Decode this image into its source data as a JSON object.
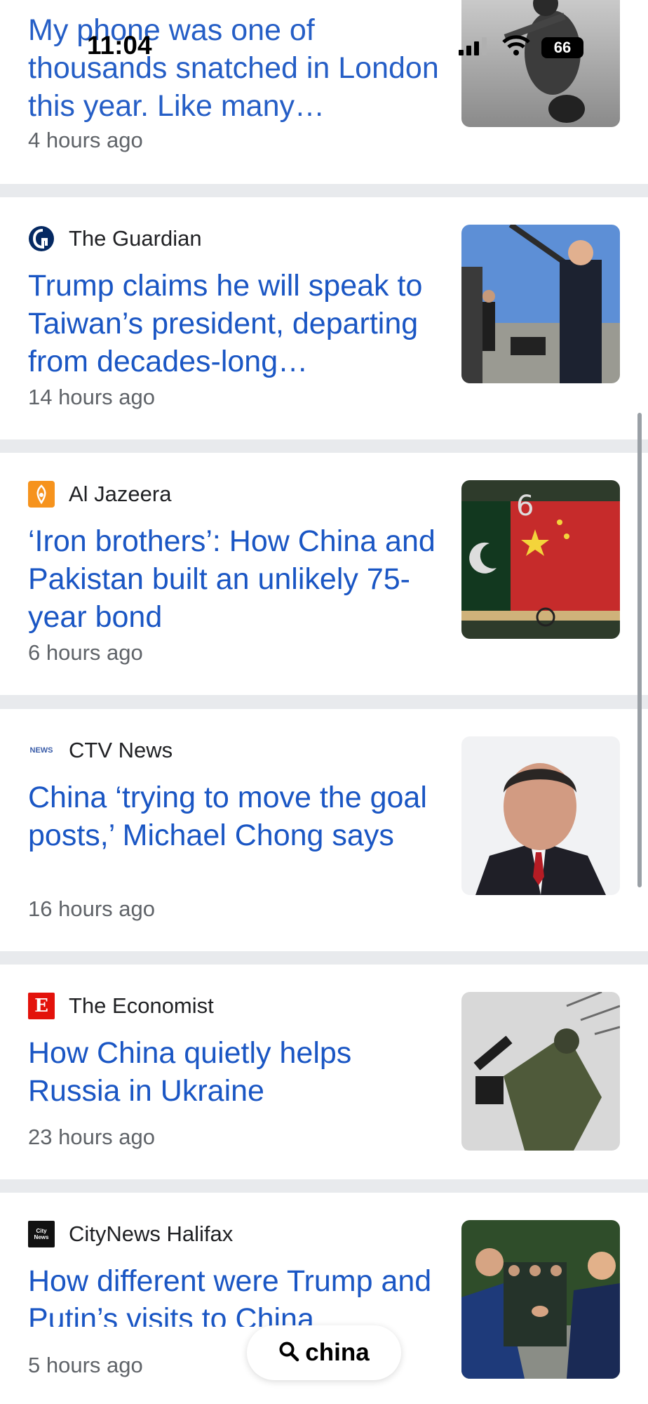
{
  "status_bar": {
    "time": "11:04",
    "battery": "66"
  },
  "articles": [
    {
      "source": "",
      "headline": "My phone was one of thousands snatched in London this year. Like many…",
      "time": "4 hours ago",
      "image": "phone-snatcher-scooter-photo"
    },
    {
      "source": "The Guardian",
      "headline": "Trump claims he will speak to Taiwan’s president, departing from decades-long…",
      "time": "14 hours ago",
      "image": "trump-at-airport-photo"
    },
    {
      "source": "Al Jazeera",
      "headline": "‘Iron brothers’: How China and Pakistan built an unlikely 75-year bond",
      "time": "6 hours ago",
      "image": "china-pakistan-flags-photo"
    },
    {
      "source": "CTV News",
      "headline": "China ‘trying to move the goal posts,’ Michael Chong says",
      "time": "16 hours ago",
      "image": "michael-chong-portrait"
    },
    {
      "source": "The Economist",
      "headline": "How China quietly helps Russia in Ukraine",
      "time": "23 hours ago",
      "image": "soldier-with-drone-photo"
    },
    {
      "source": "CityNews Halifax",
      "headline": "How different were Trump and Putin’s visits to China",
      "time": "5 hours ago",
      "image": "xi-trump-handshake-photo"
    }
  ],
  "logo_text": {
    "economist": "E",
    "ctv": "NEWS",
    "citynews": "City News"
  },
  "search": {
    "query": "china",
    "icon": "search-icon"
  },
  "colors": {
    "headline": "#1a56c4",
    "divider": "#e8eaed",
    "economist": "#e3120b",
    "aljazeera": "#f6931d",
    "guardian": "#052962"
  }
}
